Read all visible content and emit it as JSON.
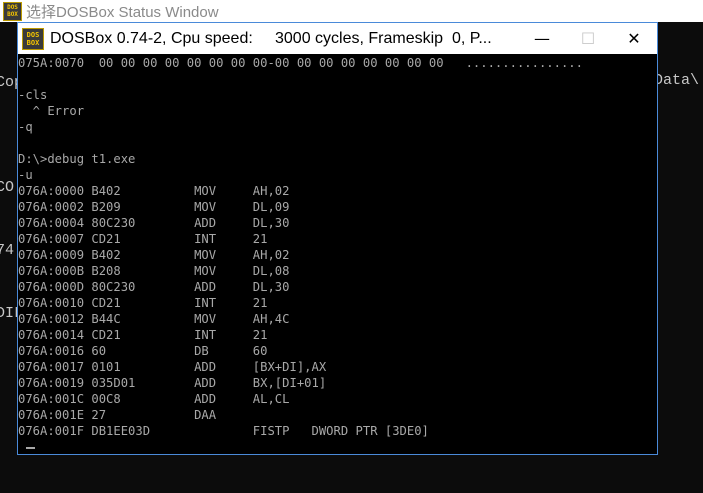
{
  "background_window": {
    "title": "选择DOSBox Status Window",
    "icon": "dosbox-icon",
    "left_fragments": [
      "Cop",
      "",
      "CO",
      "74",
      "DIL"
    ],
    "right_fragment": "Data\\"
  },
  "dos_window": {
    "title": "DOSBox 0.74-2, Cpu speed:     3000 cycles, Frameskip  0, P...",
    "icon": "dosbox-icon",
    "buttons": {
      "minimize": "—",
      "maximize": "☐",
      "close": "✕"
    },
    "console_lines": [
      "075A:0070  00 00 00 00 00 00 00 00-00 00 00 00 00 00 00 00   ................",
      "",
      "-cls",
      "  ^ Error",
      "-q",
      "",
      "D:\\>debug t1.exe",
      "-u",
      "076A:0000 B402          MOV     AH,02",
      "076A:0002 B209          MOV     DL,09",
      "076A:0004 80C230        ADD     DL,30",
      "076A:0007 CD21          INT     21",
      "076A:0009 B402          MOV     AH,02",
      "076A:000B B208          MOV     DL,08",
      "076A:000D 80C230        ADD     DL,30",
      "076A:0010 CD21          INT     21",
      "076A:0012 B44C          MOV     AH,4C",
      "076A:0014 CD21          INT     21",
      "076A:0016 60            DB      60",
      "076A:0017 0101          ADD     [BX+DI],AX",
      "076A:0019 035D01        ADD     BX,[DI+01]",
      "076A:001C 00C8          ADD     AL,CL",
      "076A:001E 27            DAA",
      "076A:001F DB1EE03D              FISTP   DWORD PTR [3DE0]"
    ],
    "prompt_cursor": "_"
  },
  "colors": {
    "console_bg": "#000000",
    "console_text": "#a8a8a8",
    "titlebar_bg": "#ffffff",
    "window_border": "#4a8ad9"
  }
}
